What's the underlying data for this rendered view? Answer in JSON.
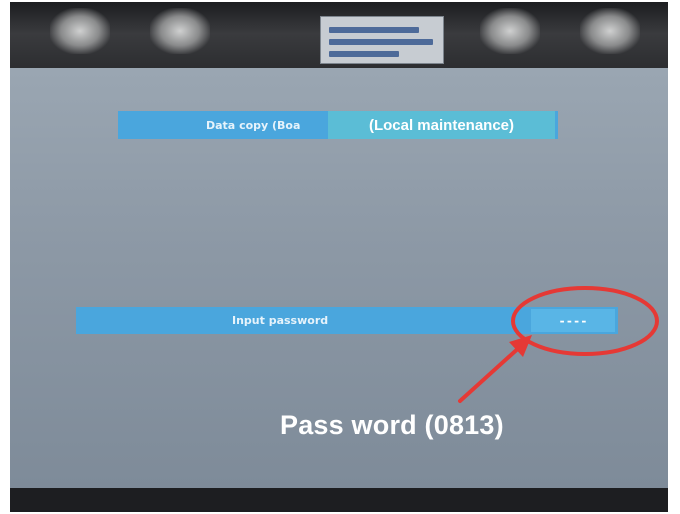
{
  "menu": {
    "data_copy_label": "Data copy (Boa",
    "mode_label": "(Local maintenance)"
  },
  "password": {
    "label": "Input password",
    "value": "----"
  },
  "annotation": {
    "text": "Pass word (0813)",
    "color": "#e53935"
  },
  "colors": {
    "screen_bg": "#8e9aa7",
    "bar": "#4aa6dd",
    "highlight": "#5bbdd6"
  }
}
